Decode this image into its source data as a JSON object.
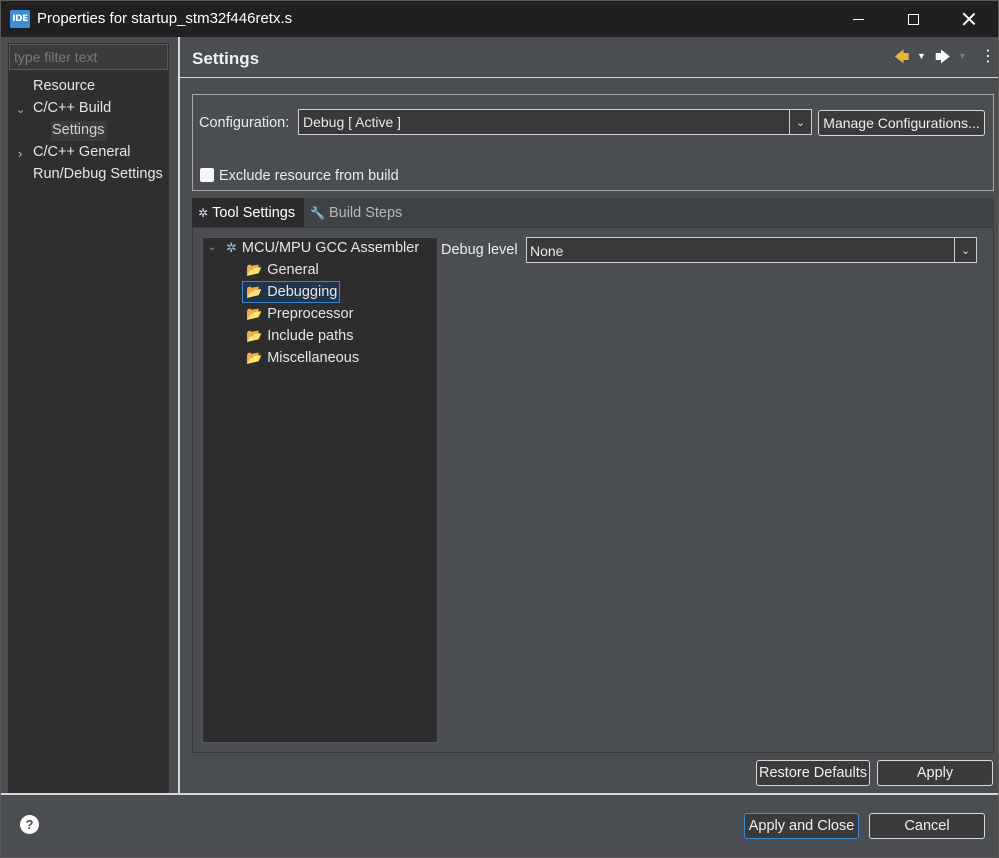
{
  "window": {
    "app_icon": "IDE",
    "title": "Properties for startup_stm32f446retx.s",
    "controls": {
      "minimize": "minimize-icon",
      "maximize": "maximize-icon",
      "close": "close-icon"
    }
  },
  "sidebar": {
    "filter_placeholder": "type filter text",
    "items": [
      {
        "label": "Resource"
      },
      {
        "label": "C/C++ Build"
      },
      {
        "label": "Settings"
      },
      {
        "label": "C/C++ General"
      },
      {
        "label": "Run/Debug Settings"
      }
    ]
  },
  "header": {
    "title": "Settings",
    "back_glyph": "🡄",
    "forward_glyph": "🡆",
    "dropdown_glyph": "▼",
    "menu_glyph": "⋮"
  },
  "configuration": {
    "label": "Configuration:",
    "value": "Debug  [ Active ]",
    "manage_label": "Manage Configurations...",
    "exclude_label": "Exclude resource from build"
  },
  "tabs": [
    {
      "label": "Tool Settings",
      "icon": "gear-icon"
    },
    {
      "label": "Build Steps",
      "icon": "wrench-icon"
    }
  ],
  "tool_tree": {
    "root": "MCU/MPU GCC Assembler",
    "children": [
      "General",
      "Debugging",
      "Preprocessor",
      "Include paths",
      "Miscellaneous"
    ]
  },
  "debug": {
    "label": "Debug level",
    "value": "None"
  },
  "buttons": {
    "restore_defaults": "Restore Defaults",
    "apply": "Apply",
    "apply_and_close": "Apply and Close",
    "cancel": "Cancel",
    "help": "?"
  },
  "colors": {
    "accent": "#3b86c8",
    "panel": "#4a4d51",
    "folder": "#e5b450"
  }
}
